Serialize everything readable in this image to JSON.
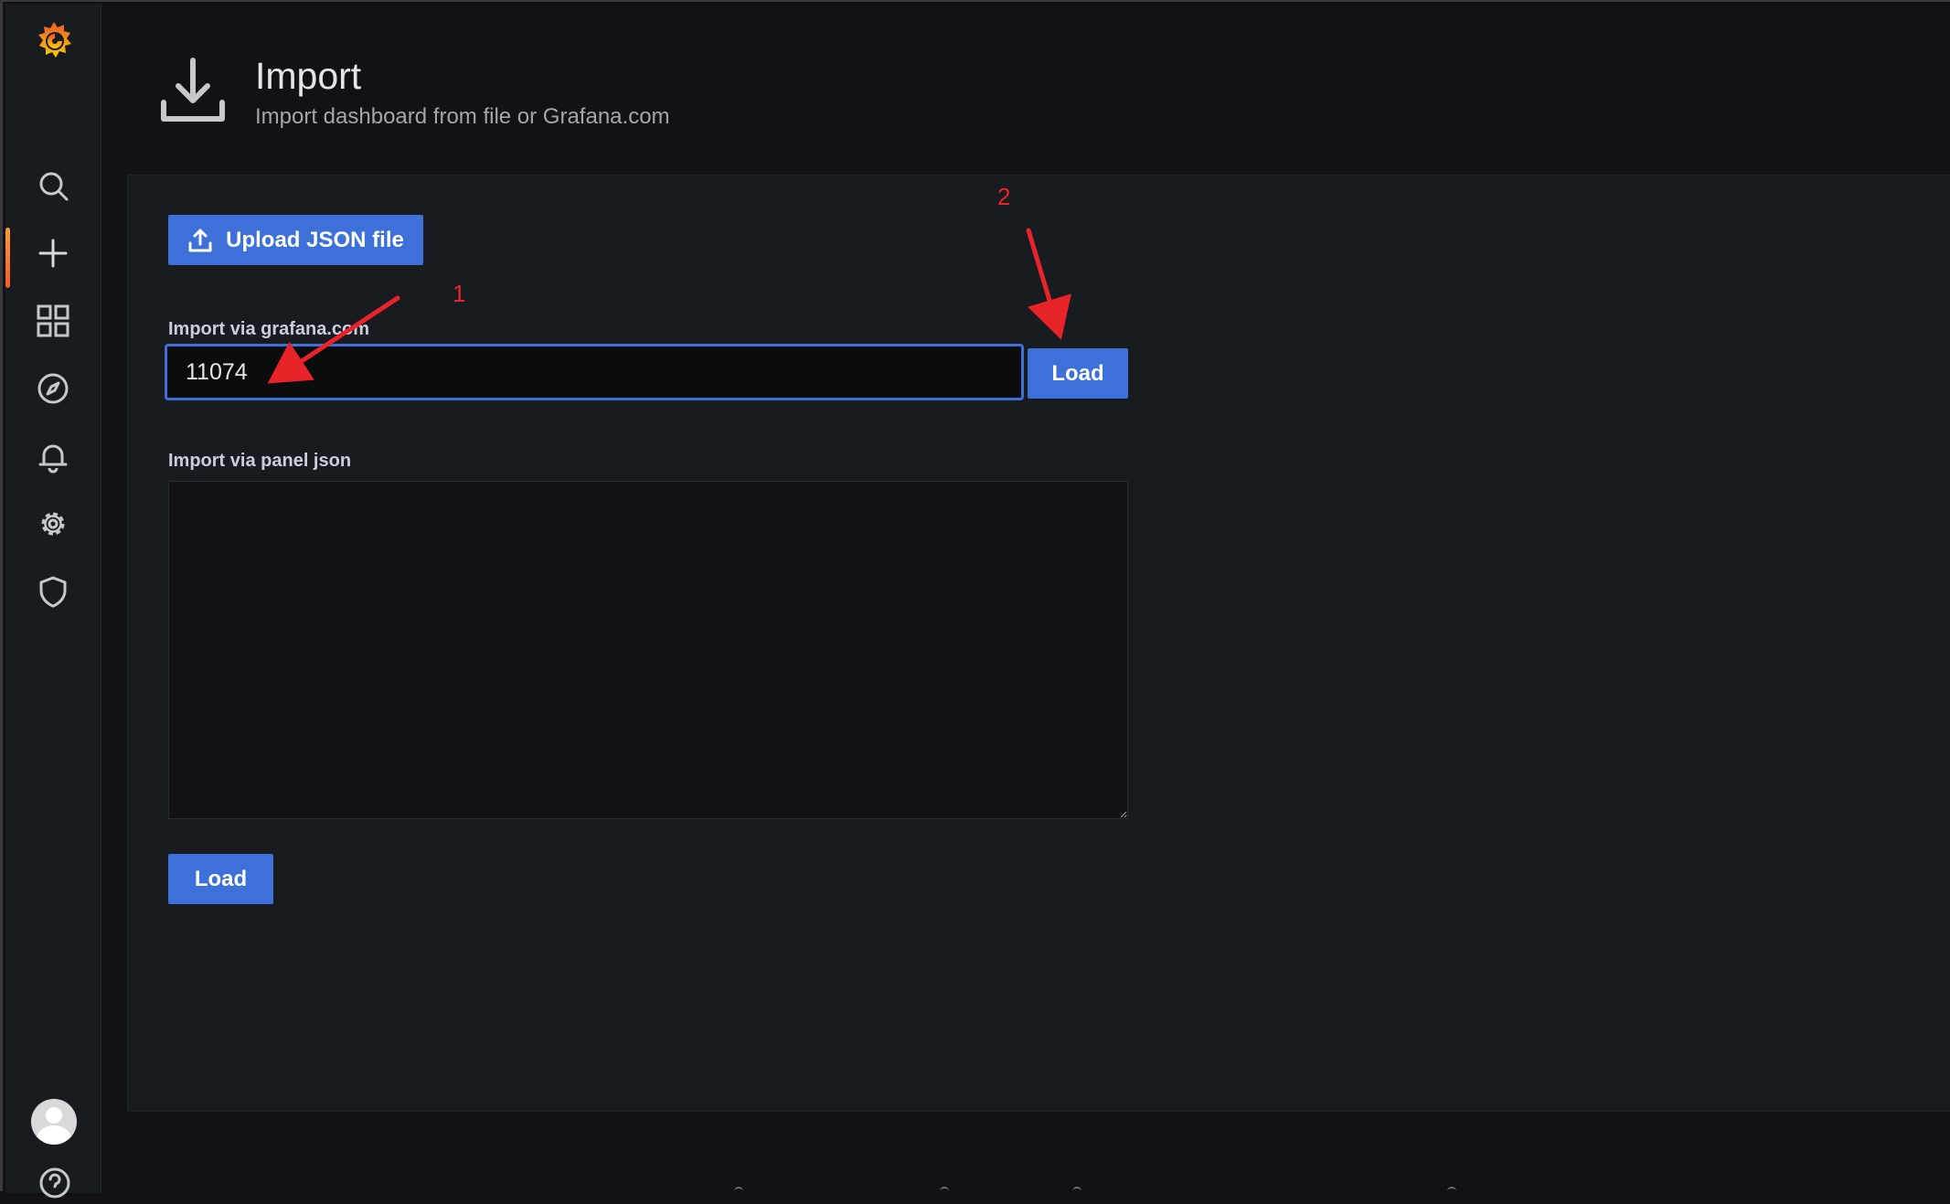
{
  "sidebar": {
    "items": [
      {
        "name": "search",
        "icon": "search-icon"
      },
      {
        "name": "create",
        "icon": "plus-icon",
        "active": true
      },
      {
        "name": "dashboards",
        "icon": "apps-icon"
      },
      {
        "name": "explore",
        "icon": "compass-icon"
      },
      {
        "name": "alerting",
        "icon": "bell-icon"
      },
      {
        "name": "configuration",
        "icon": "cog-icon"
      },
      {
        "name": "server-admin",
        "icon": "shield-icon"
      }
    ],
    "bottom": [
      "avatar",
      "question-circle-icon"
    ]
  },
  "header": {
    "title": "Import",
    "subtitle": "Import dashboard from file or Grafana.com",
    "icon": "import-download-icon"
  },
  "form": {
    "upload_label": "Upload JSON file",
    "grafana_label": "Import via grafana.com",
    "grafana_value": "11074",
    "load_label": "Load",
    "panel_json_label": "Import via panel json",
    "panel_json_value": "",
    "load_bottom_label": "Load"
  },
  "annotations": {
    "label_1": "1",
    "label_2": "2",
    "color": "#e8232a"
  },
  "colors": {
    "primary_button": "#3d71d9",
    "background": "#111217",
    "panel": "#181b1f",
    "active_indicator": "#f05a28"
  }
}
